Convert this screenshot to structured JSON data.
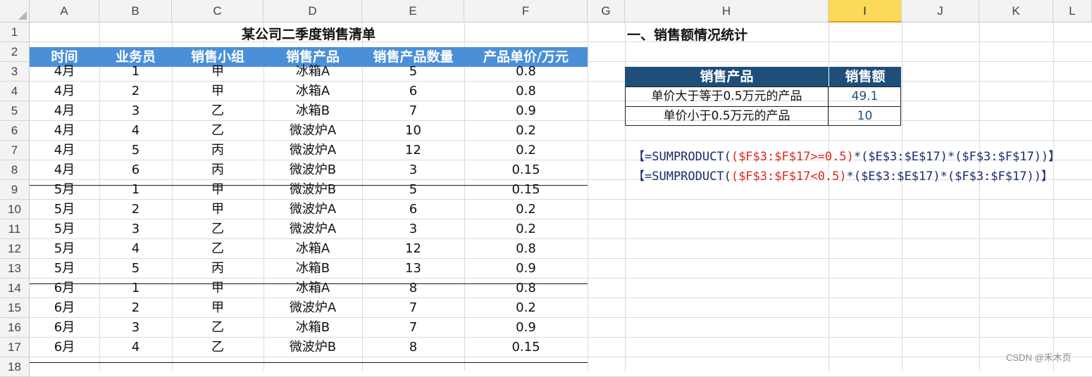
{
  "columns": [
    "A",
    "B",
    "C",
    "D",
    "E",
    "F",
    "G",
    "H",
    "I",
    "J",
    "K",
    "L"
  ],
  "selected_column": "I",
  "rows": [
    "1",
    "2",
    "3",
    "4",
    "5",
    "6",
    "7",
    "8",
    "9",
    "10",
    "11",
    "12",
    "13",
    "14",
    "15",
    "16",
    "17",
    "18"
  ],
  "table": {
    "title": "某公司二季度销售清单",
    "headers": [
      "时间",
      "业务员",
      "销售小组",
      "销售产品",
      "销售产品数量",
      "产品单价/万元"
    ],
    "data": [
      [
        "4月",
        "1",
        "甲",
        "冰箱A",
        "5",
        "0.8"
      ],
      [
        "4月",
        "2",
        "甲",
        "冰箱A",
        "6",
        "0.8"
      ],
      [
        "4月",
        "3",
        "乙",
        "冰箱B",
        "7",
        "0.9"
      ],
      [
        "4月",
        "4",
        "乙",
        "微波炉A",
        "10",
        "0.2"
      ],
      [
        "4月",
        "5",
        "丙",
        "微波炉A",
        "12",
        "0.2"
      ],
      [
        "4月",
        "6",
        "丙",
        "微波炉B",
        "3",
        "0.15"
      ],
      [
        "5月",
        "1",
        "甲",
        "微波炉B",
        "5",
        "0.15"
      ],
      [
        "5月",
        "2",
        "甲",
        "微波炉A",
        "6",
        "0.2"
      ],
      [
        "5月",
        "3",
        "乙",
        "微波炉A",
        "3",
        "0.2"
      ],
      [
        "5月",
        "4",
        "乙",
        "冰箱A",
        "12",
        "0.8"
      ],
      [
        "5月",
        "5",
        "丙",
        "冰箱B",
        "13",
        "0.9"
      ],
      [
        "6月",
        "1",
        "甲",
        "冰箱A",
        "8",
        "0.8"
      ],
      [
        "6月",
        "2",
        "甲",
        "微波炉A",
        "7",
        "0.2"
      ],
      [
        "6月",
        "3",
        "乙",
        "冰箱B",
        "7",
        "0.9"
      ],
      [
        "6月",
        "4",
        "乙",
        "微波炉B",
        "8",
        "0.15"
      ]
    ]
  },
  "summary": {
    "heading": "一、销售额情况统计",
    "col1": "销售产品",
    "col2": "销售额",
    "rows": [
      {
        "label": "单价大于等于0.5万元的产品",
        "value": "49.1"
      },
      {
        "label": "单价小于0.5万元的产品",
        "value": "10"
      }
    ]
  },
  "formulas": [
    {
      "open": "【=SUMPRODUCT(",
      "cond": "($F$3:$F$17>=0.5)",
      "rest": "*($E$3:$E$17)*($F$3:$F$17))】"
    },
    {
      "open": "【=SUMPRODUCT(",
      "cond": "($F$3:$F$17<0.5)",
      "rest": "*($E$3:$E$17)*($F$3:$F$17))】"
    }
  ],
  "watermark": "CSDN @禾木页",
  "colors": {
    "header_band": "#4a90d9",
    "summary_header": "#1f4e79",
    "formula_red": "#e3241c",
    "formula_dark": "#1a2a6c"
  }
}
